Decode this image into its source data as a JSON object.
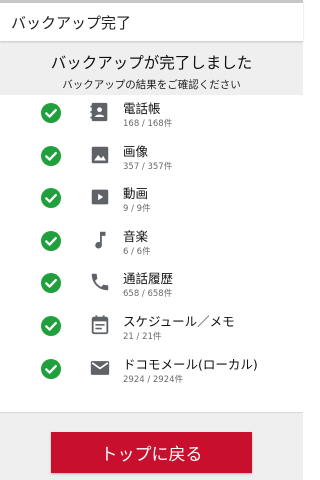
{
  "header": {
    "title": "バックアップ完了"
  },
  "banner": {
    "title": "バックアップが完了しました",
    "subtitle": "バックアップの結果をご確認ください"
  },
  "results": [
    {
      "icon": "contacts-icon",
      "label": "電話帳",
      "count": "168 / 168件"
    },
    {
      "icon": "image-icon",
      "label": "画像",
      "count": "357 / 357件"
    },
    {
      "icon": "video-icon",
      "label": "動画",
      "count": "9 / 9件"
    },
    {
      "icon": "music-note-icon",
      "label": "音楽",
      "count": "6 / 6件"
    },
    {
      "icon": "phone-icon",
      "label": "通話履歴",
      "count": "658 / 658件"
    },
    {
      "icon": "calendar-memo-icon",
      "label": "スケジュール／メモ",
      "count": "21 / 21件"
    },
    {
      "icon": "mail-icon",
      "label": "ドコモメール(ローカル)",
      "count": "2924 / 2924件"
    }
  ],
  "status_icon": "check-circle-icon",
  "footer": {
    "button_label": "トップに戻る"
  },
  "colors": {
    "success": "#1fa03d",
    "primary": "#c8102e",
    "icon": "#5f6368",
    "band_background": "#efefef"
  }
}
